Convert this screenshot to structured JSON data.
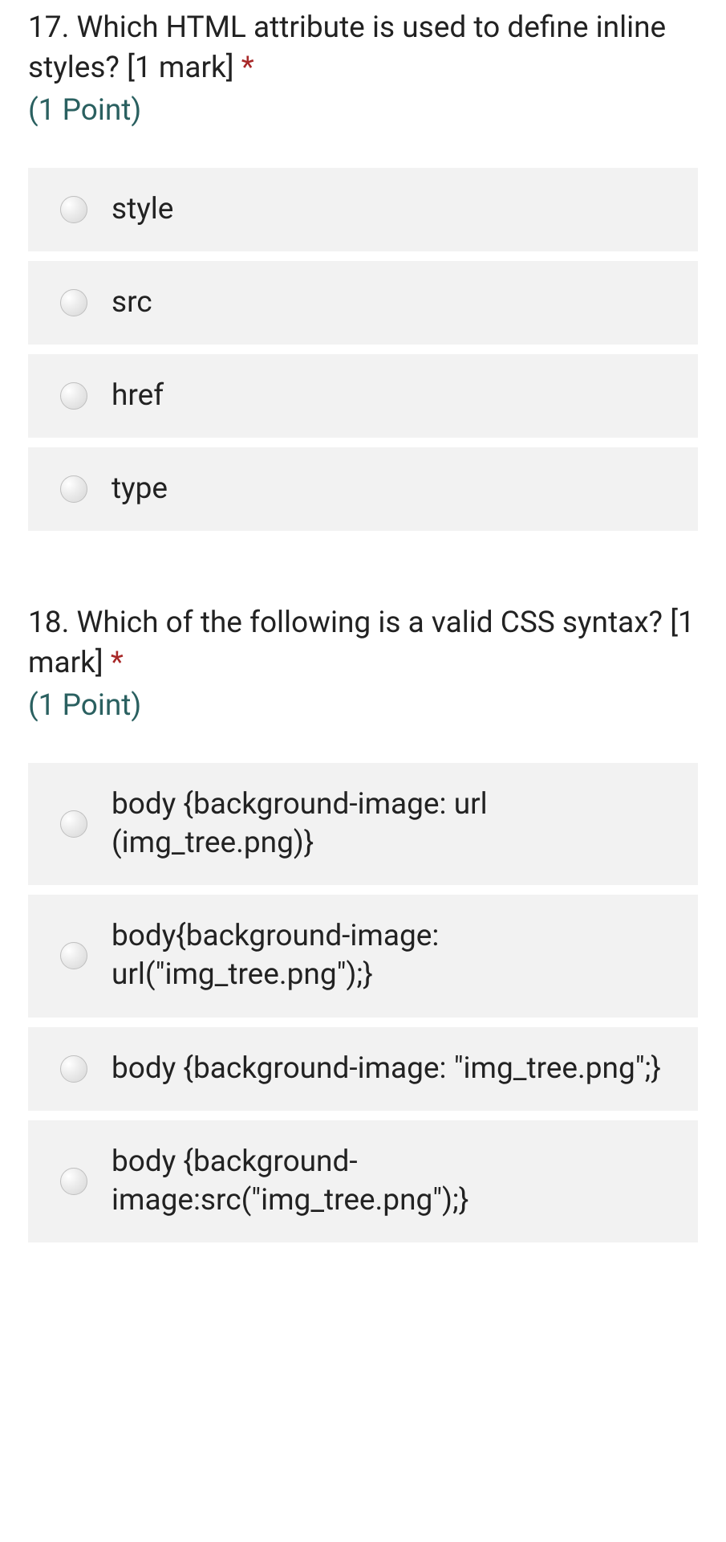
{
  "questions": [
    {
      "number": "17.",
      "text": "Which HTML attribute is used to define inline styles?        [1 mark]",
      "required": "*",
      "points": "(1 Point)",
      "options": [
        "style",
        "src",
        "href",
        "type"
      ]
    },
    {
      "number": "18.",
      "text": "Which of the following is a valid CSS syntax?        [1 mark]",
      "required": "*",
      "points": "(1 Point)",
      "options": [
        "body {background-image: url (img_tree.png)}",
        "body{background-image: url(\"img_tree.png\");}",
        "body {background-image: \"img_tree.png\";}",
        "body {background-image:src(\"img_tree.png\");}"
      ]
    }
  ]
}
